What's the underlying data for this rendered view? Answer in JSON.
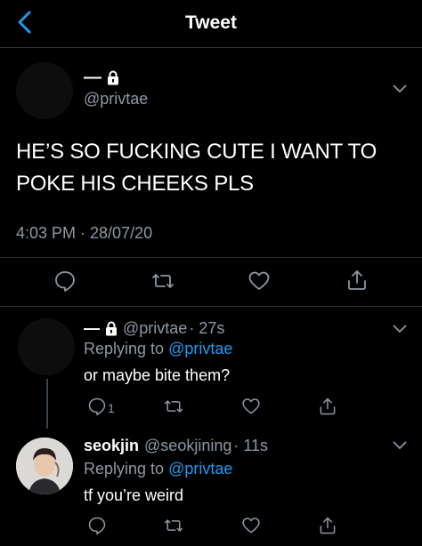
{
  "header": {
    "title": "Tweet"
  },
  "main_tweet": {
    "name": "—",
    "handle": "@privtae",
    "text": "HE’S SO FUCKING CUTE I WANT TO POKE HIS CHEEKS PLS",
    "timestamp": "4:03 PM · 28/07/20"
  },
  "replies": [
    {
      "name": "—",
      "handle": "@privtae",
      "time": "· 27s",
      "replying_prefix": "Replying to",
      "replying_to": "@privtae",
      "text": "or maybe bite them?",
      "reply_count": "1"
    },
    {
      "name": "seokjin",
      "handle": "@seokjining",
      "time": "· 11s",
      "replying_prefix": "Replying to",
      "replying_to": "@privtae",
      "text": "tf you’re weird"
    }
  ],
  "icons": [
    "back-icon",
    "lock-icon",
    "chevron-down-icon",
    "reply-icon",
    "retweet-icon",
    "like-icon",
    "share-icon"
  ],
  "colors": {
    "background": "#000000",
    "accent": "#1d9bf0",
    "muted": "#8b98a5",
    "divider": "#2f3336"
  }
}
